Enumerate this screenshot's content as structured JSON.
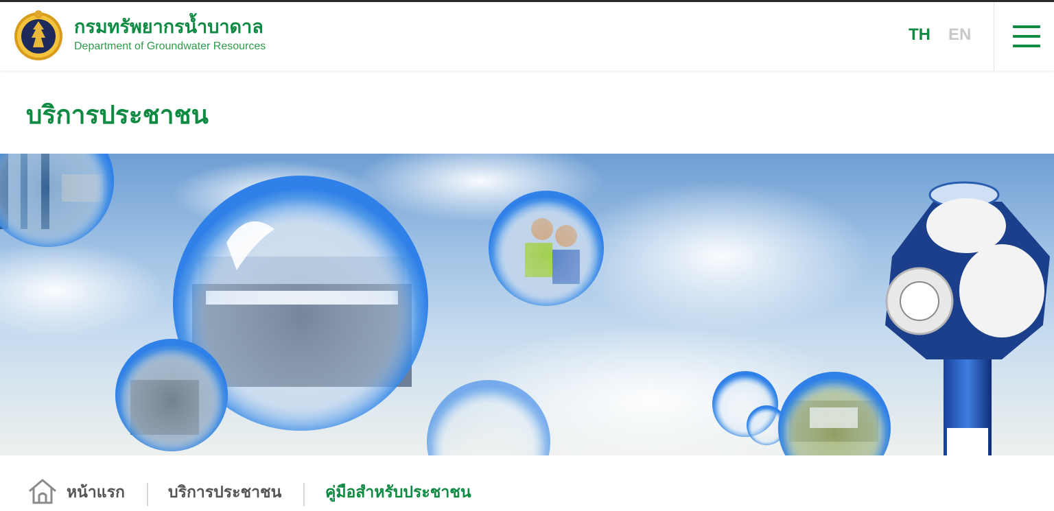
{
  "header": {
    "org_name_th": "กรมทรัพยากรน้ำบาดาล",
    "org_name_en": "Department of Groundwater Resources",
    "logo_icon": "department-seal-icon",
    "languages": [
      "TH",
      "EN"
    ],
    "active_language": "TH",
    "menu_icon": "hamburger-menu-icon"
  },
  "page": {
    "title": "บริการประชาชน"
  },
  "banner": {
    "theme": "water-bubbles-sky",
    "colors": {
      "sky_top": "#6e9ed3",
      "sky_bottom": "#eef1ee",
      "bubble": "#2f80e8"
    }
  },
  "breadcrumb": {
    "home_icon": "home-icon",
    "items": [
      "หน้าแรก",
      "บริการประชาชน",
      "คู่มือสำหรับประชาชน"
    ]
  },
  "colors": {
    "brand_green": "#0f8a43",
    "inactive_gray": "#c8c8c8",
    "breadcrumb_gray": "#555555"
  }
}
